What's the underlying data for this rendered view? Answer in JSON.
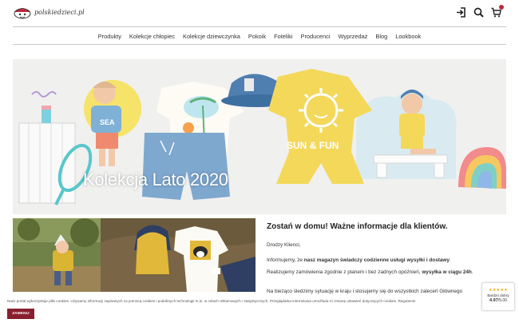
{
  "header": {
    "logo_text": "polskiedzieci.pl",
    "icons": [
      "login-icon",
      "search-icon",
      "cart-icon"
    ]
  },
  "nav": {
    "items": [
      "Produkty",
      "Kolekcje chłopiec",
      "Kolekcje dziewczynka",
      "Pokoik",
      "Foteliki",
      "Producenci",
      "Wyprzedaż",
      "Blog",
      "Lookbook"
    ]
  },
  "hero": {
    "title": "Kolekcja Lato 2020",
    "shirt_text": "SUN & FUN",
    "tee_text": "SEA"
  },
  "article": {
    "heading": "Zostań w domu! Ważne informacje dla klientów.",
    "greeting": "Drodzy Klienci,",
    "p1_pre": "Informujemy, że ",
    "p1_bold": "nasz magazyn świadczy codzienne usługi wysyłki i dostawy",
    "p1_post": ".",
    "p2_pre": "Realizujemy zamówienia zgodnie z planem i bez żadnych opóźnień, ",
    "p2_bold": "wysyłka w ciągu 24h",
    "p2_post": ".",
    "p3": "Na bieżąco śledzimy sytuację w kraju i stosujemy się do wszystkich zaleceń Głównego"
  },
  "cookie": {
    "text": "Nasz portal wykorzystuje pliki cookies. Używamy informacji zapisanych za pomocą cookies i podobnych technologii m.in. w celach reklamowych i statystycznych. Przeglądarka internetowa umożliwia Ci zmianę ustawień dotyczących cookies. Regulamin",
    "button": "ZAMKNIJ"
  },
  "rating": {
    "stars": "★★★★★",
    "label": "Bardzo dobry",
    "score": "4.97",
    "max": "/5.00"
  },
  "colors": {
    "accent": "#8a1e2e",
    "cart_badge": "#c0283d",
    "star": "#f0a500"
  }
}
